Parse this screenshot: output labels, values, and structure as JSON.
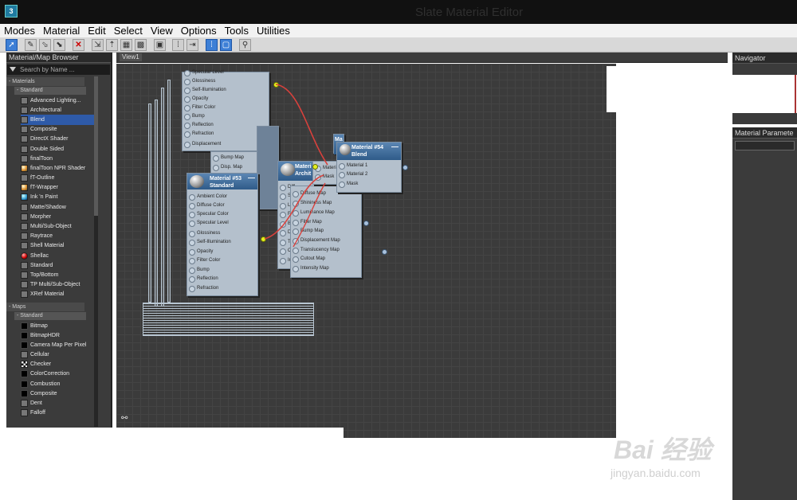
{
  "window": {
    "title": "Slate Material Editor",
    "app_icon": "3ds-max-icon"
  },
  "menu": [
    "Modes",
    "Material",
    "Edit",
    "Select",
    "View",
    "Options",
    "Tools",
    "Utilities"
  ],
  "toolbar": {
    "icons": [
      "select-arrow-icon",
      "pick-material-icon",
      "put-material-icon",
      "assign-material-icon",
      "delete-icon",
      "move-children-icon",
      "hide-unused-icon",
      "show-background-icon",
      "background-checker-icon",
      "show-map-icon",
      "layout-all-icon",
      "layout-children-icon",
      "select-tool-icon",
      "show-end-result-icon",
      "zoom-icon"
    ]
  },
  "browser": {
    "title": "Material/Map Browser",
    "search_placeholder": "Search by Name ...",
    "materials": {
      "category": "- Materials",
      "group": "- Standard",
      "items": [
        {
          "label": "Advanced Lighting...",
          "swatch": "gray"
        },
        {
          "label": "Architectural",
          "swatch": "gray"
        },
        {
          "label": "Blend",
          "swatch": "gray"
        },
        {
          "label": "Composite",
          "swatch": "gray"
        },
        {
          "label": "DirectX Shader",
          "swatch": "gray"
        },
        {
          "label": "Double Sided",
          "swatch": "gray"
        },
        {
          "label": "finalToon",
          "swatch": "gray"
        },
        {
          "label": "finalToon NPR Shader",
          "swatch": "orange"
        },
        {
          "label": "fT-Outline",
          "swatch": "gray"
        },
        {
          "label": "fT-Wrapper",
          "swatch": "orange"
        },
        {
          "label": "Ink 'n Paint",
          "swatch": "blue"
        },
        {
          "label": "Matte/Shadow",
          "swatch": "gray"
        },
        {
          "label": "Morpher",
          "swatch": "gray"
        },
        {
          "label": "Multi/Sub-Object",
          "swatch": "gray"
        },
        {
          "label": "Raytrace",
          "swatch": "gray"
        },
        {
          "label": "Shell Material",
          "swatch": "gray"
        },
        {
          "label": "Shellac",
          "swatch": "red"
        },
        {
          "label": "Standard",
          "swatch": "gray"
        },
        {
          "label": "Top/Bottom",
          "swatch": "gray"
        },
        {
          "label": "TP Multi/Sub-Object",
          "swatch": "gray"
        },
        {
          "label": "XRef Material",
          "swatch": "gray"
        }
      ],
      "selected": "Blend"
    },
    "maps": {
      "category": "- Maps",
      "group": "- Standard",
      "items": [
        {
          "label": "Bitmap",
          "swatch": "black"
        },
        {
          "label": "BitmapHDR",
          "swatch": "black"
        },
        {
          "label": "Camera Map Per Pixel",
          "swatch": "black"
        },
        {
          "label": "Cellular",
          "swatch": "gray"
        },
        {
          "label": "Checker",
          "swatch": "check"
        },
        {
          "label": "ColorCorrection",
          "swatch": "black"
        },
        {
          "label": "Combustion",
          "swatch": "black"
        },
        {
          "label": "Composite",
          "swatch": "black"
        },
        {
          "label": "Dent",
          "swatch": "gray"
        },
        {
          "label": "Falloff",
          "swatch": "gray"
        }
      ]
    }
  },
  "view": {
    "tab": "View1",
    "nodes": {
      "top_slots": [
        "Specular Level",
        "Glossiness",
        "Self-Illumination",
        "Opacity",
        "Filter Color",
        "Bump",
        "Reflection",
        "Refraction",
        "Displacement"
      ],
      "map_slots": [
        "Bump Map",
        "Disp. Map"
      ],
      "m53": {
        "name": "Material #53",
        "type": "Standard",
        "slots": [
          "Ambient Color",
          "Diffuse Color",
          "Specular Color",
          "Specular Level",
          "Glossiness",
          "Self-Illumination",
          "Opacity",
          "Filter Color",
          "Bump",
          "Reflection",
          "Refraction"
        ]
      },
      "arch": {
        "name": "Materi",
        "type": "Archit",
        "slots": [
          "Diff",
          "Shi",
          "Lu",
          "Filt",
          "Bu",
          "Dis",
          "Tra",
          "Cut",
          "Inte"
        ],
        "maps": [
          "Diffuse Map",
          "Shininess Map",
          "Luminance Map",
          "Filter Map",
          "Bump Map",
          "Displacement Map",
          "Translucency Map",
          "Cutout Map",
          "Intensity Map"
        ]
      },
      "m54": {
        "name": "Material #54",
        "type": "Blend",
        "slots": [
          "Material 1",
          "Material 2",
          "Mask"
        ]
      },
      "mid": {
        "slots": [
          "Materi",
          "Mask"
        ],
        "top_label": "Ma"
      }
    }
  },
  "navigator": {
    "title": "Navigator"
  },
  "material_parameters": {
    "title": "Material Paramete"
  },
  "watermark": {
    "text": "Bai 经验",
    "url_text": "jingyan.baidu.com"
  },
  "colors": {
    "accent": "#3d7fd6",
    "wire": "#d9413c",
    "port_active": "#e4f020",
    "node_head": "#2f5b89"
  }
}
